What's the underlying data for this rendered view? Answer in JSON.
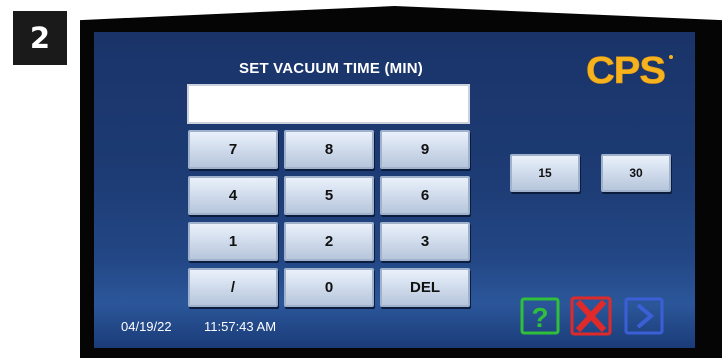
{
  "step_badge": "2",
  "screen": {
    "title": "SET VACUUM TIME (MIN)",
    "logo": {
      "text": "CPS",
      "color": "#f6b31d"
    },
    "entry_value": ""
  },
  "keypad": {
    "keys": [
      "7",
      "8",
      "9",
      "4",
      "5",
      "6",
      "1",
      "2",
      "3",
      "/",
      "0",
      "DEL"
    ]
  },
  "presets": [
    "15",
    "30"
  ],
  "actions": {
    "help_icon": "help-icon",
    "cancel_icon": "cancel-icon",
    "next_icon": "next-icon",
    "help_color": "#2fbf3a",
    "cancel_color": "#e02a2a",
    "next_color": "#3b5fd6"
  },
  "status": {
    "date": "04/19/22",
    "time": "11:57:43 AM"
  }
}
